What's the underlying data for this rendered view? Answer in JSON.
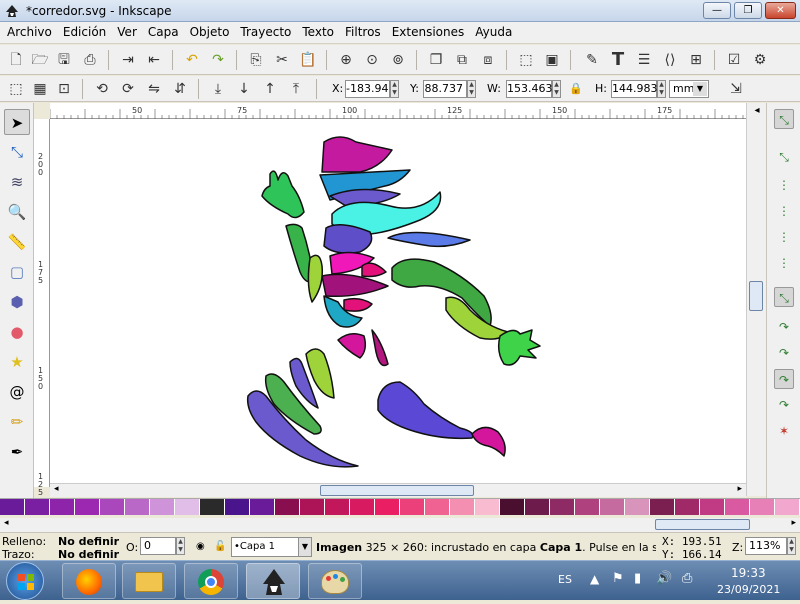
{
  "window": {
    "title": "*corredor.svg - Inkscape",
    "buttons": {
      "minimize": "—",
      "maximize": "❐",
      "close": "✕"
    }
  },
  "menu": [
    "Archivo",
    "Edición",
    "Ver",
    "Capa",
    "Objeto",
    "Trayecto",
    "Texto",
    "Filtros",
    "Extensiones",
    "Ayuda"
  ],
  "toolbar1_icons": [
    "new-icon",
    "open-icon",
    "save-icon",
    "print-icon",
    "import-icon",
    "export-icon",
    "undo-icon",
    "redo-icon",
    "copy-icon",
    "cut-icon",
    "paste-icon",
    "zoom-selection-icon",
    "zoom-drawing-icon",
    "zoom-page-icon",
    "duplicate-icon",
    "clone-icon",
    "unlink-clone-icon",
    "group-icon",
    "ungroup-icon",
    "fill-stroke-icon",
    "text-font-icon",
    "layers-icon",
    "xml-editor-icon",
    "align-icon",
    "preferences-icon",
    "document-properties-icon"
  ],
  "coords": {
    "x_label": "X:",
    "x_value": "-183.94",
    "y_label": "Y:",
    "y_value": "88.737",
    "w_label": "W:",
    "w_value": "153.463",
    "h_label": "H:",
    "h_value": "144.983",
    "unit": "mm"
  },
  "ruler_h": [
    "50",
    "75",
    "100",
    "125",
    "150",
    "175"
  ],
  "ruler_v": [
    "2\n0\n0",
    "1\n7\n5",
    "1\n5\n0",
    "1\n2\n5"
  ],
  "palette": [
    "#6a1b9a",
    "#7b1fa2",
    "#8e24aa",
    "#9c27b0",
    "#ab47bc",
    "#ba68c8",
    "#ce93d8",
    "#e1bee7",
    "#2a2a2a",
    "#4a148c",
    "#6a1b9a",
    "#880e4f",
    "#ad1457",
    "#c2185b",
    "#d81b60",
    "#e91e63",
    "#ec407a",
    "#f06292",
    "#f48fb1",
    "#f8bbd0",
    "#4a0e2e",
    "#6d1b4b",
    "#8e2a64",
    "#b0417f",
    "#c66ba0",
    "#d994bc",
    "#7a1f4f",
    "#a02a68",
    "#c13b84",
    "#d95aa0",
    "#e880b8",
    "#f2a7cf"
  ],
  "status": {
    "fill_label": "Relleno:",
    "fill_value": "No definir",
    "stroke_label": "Trazo:",
    "stroke_value": "No definir",
    "opacity_label": "O:",
    "opacity_value": "0",
    "layer": "•Capa 1",
    "message_bold": "Imagen",
    "message_rest": " 325 × 260: incrustado en capa ",
    "message_layer": "Capa 1",
    "message_tail": ". Pulse en la selecc...",
    "cursor_x": "X: 193.51",
    "cursor_y": "Y: 166.14",
    "zoom_label": "Z:",
    "zoom_value": "113%"
  },
  "taskbar": {
    "lang": "ES",
    "time": "19:33",
    "date": "23/09/2021"
  }
}
